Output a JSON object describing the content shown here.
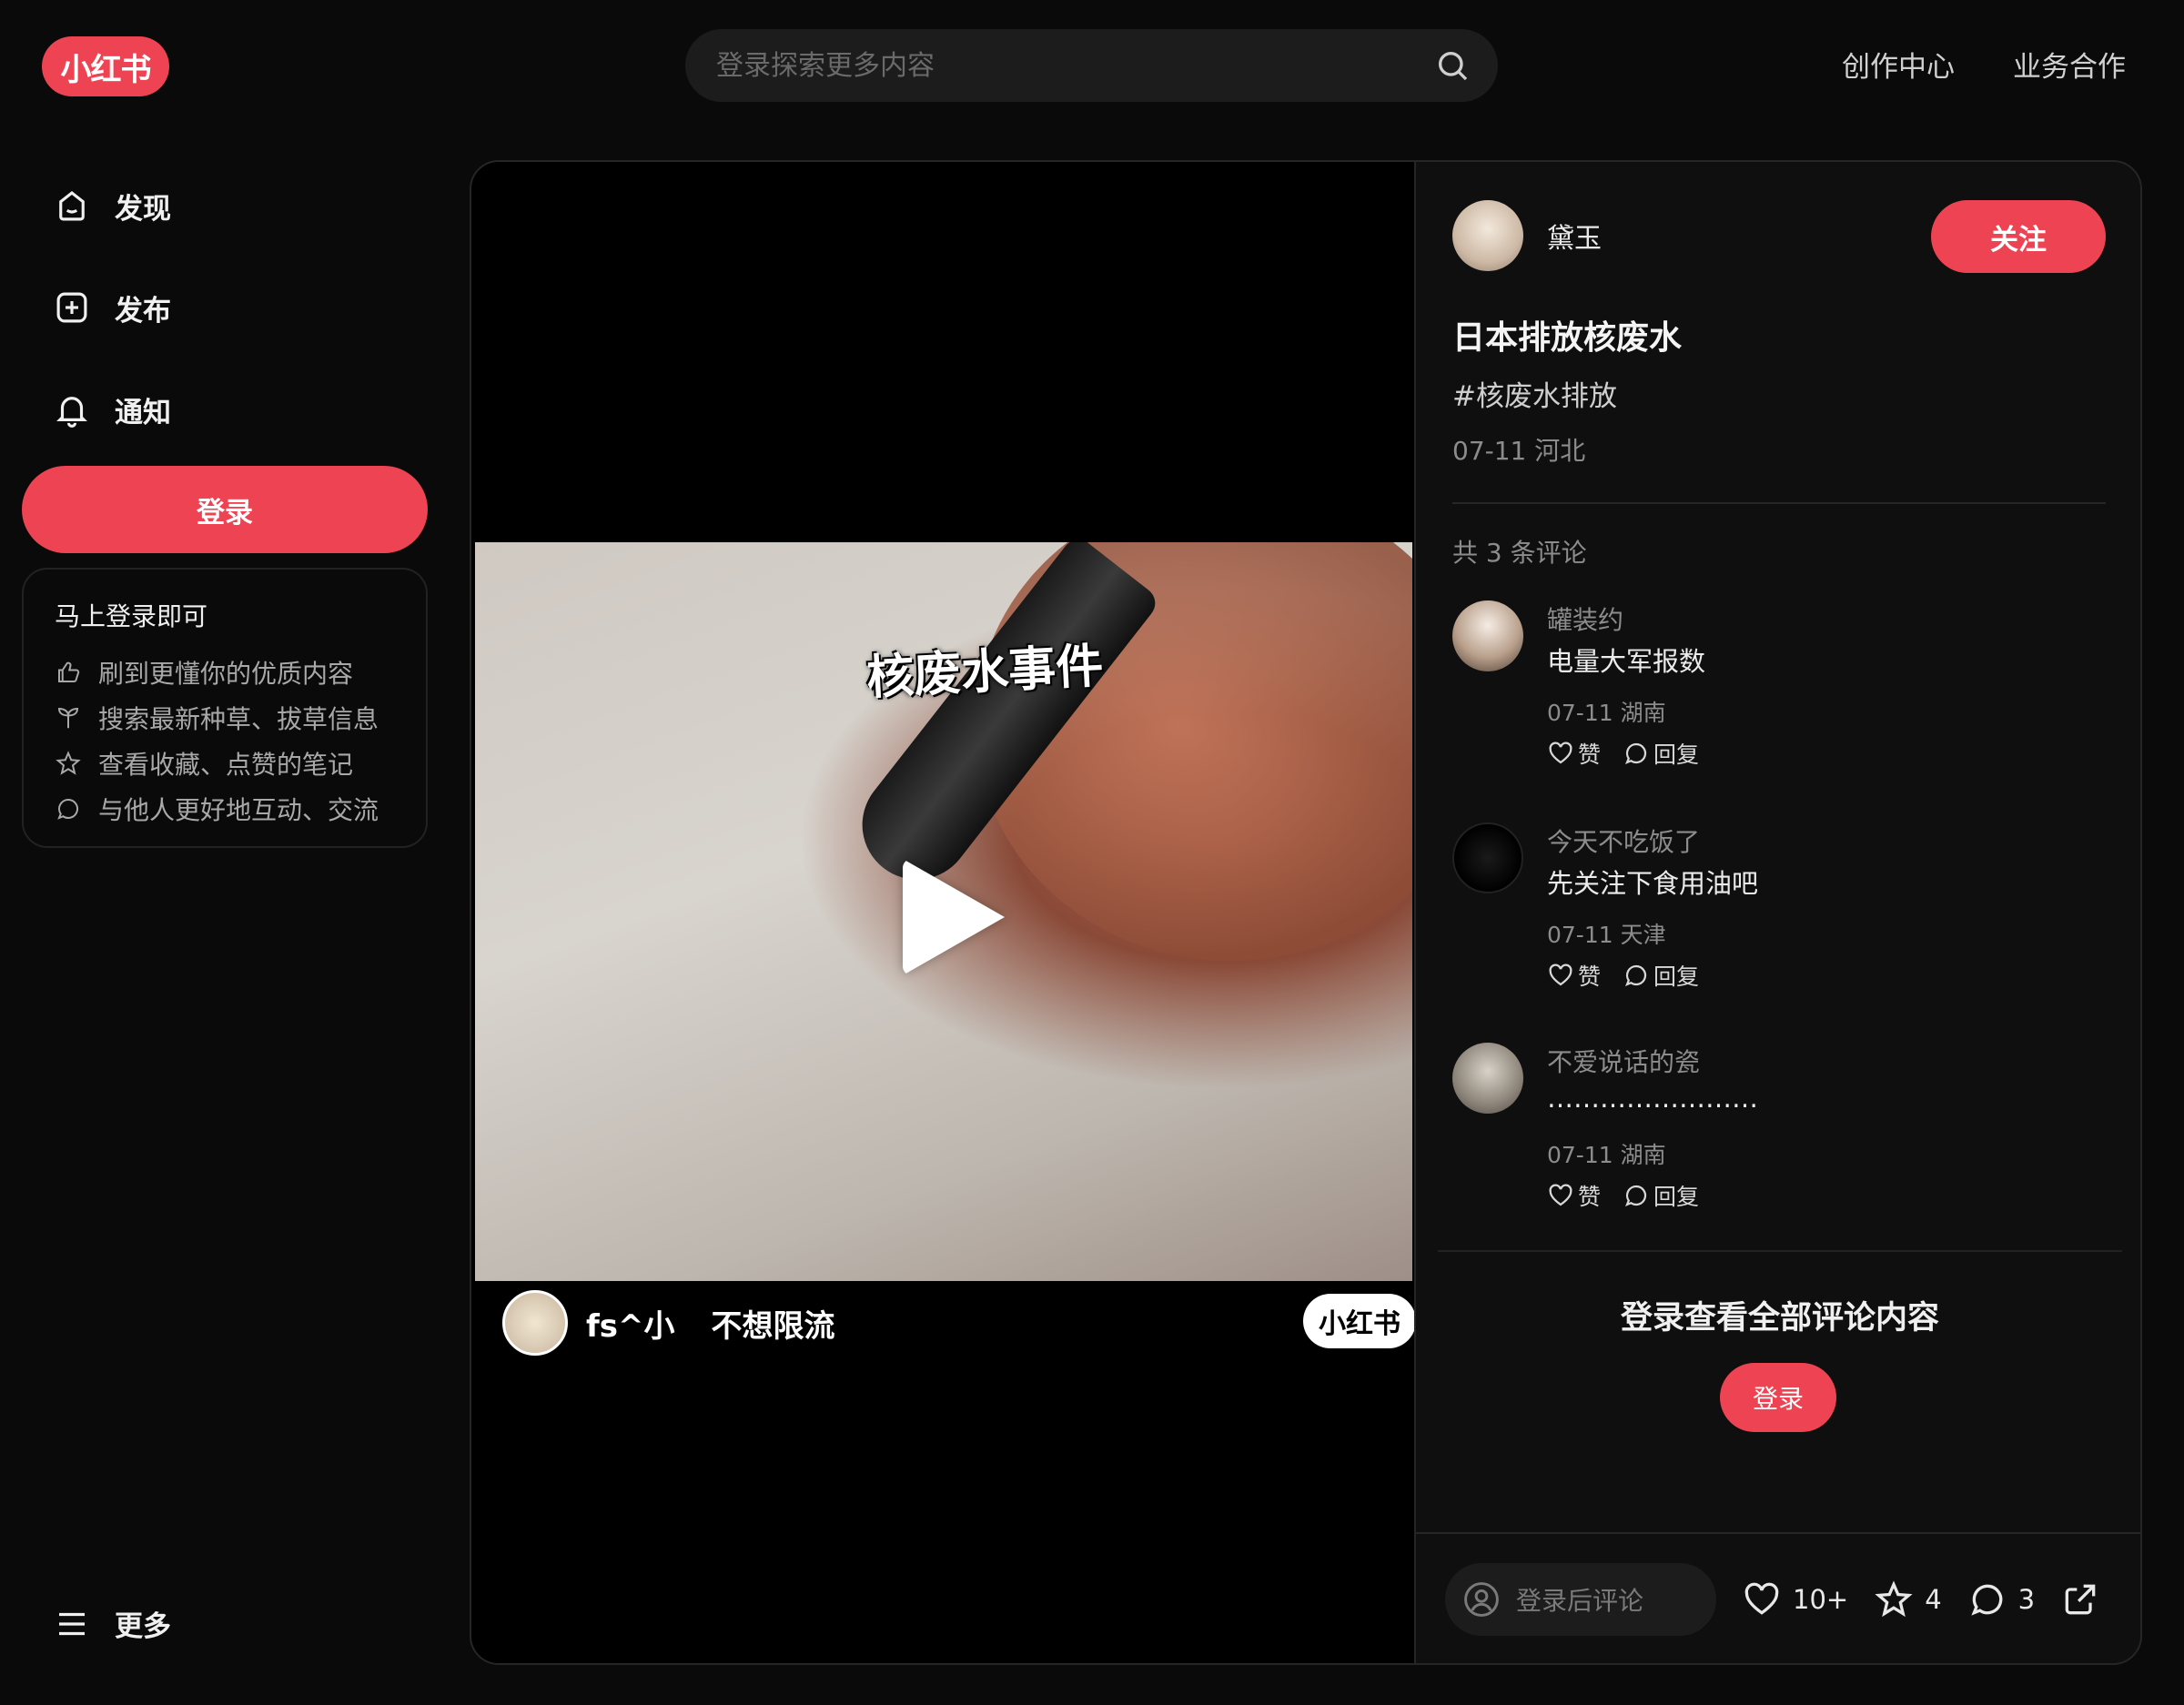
{
  "header": {
    "logo": "小红书",
    "search_placeholder": "登录探索更多内容",
    "links": [
      "创作中心",
      "业务合作"
    ]
  },
  "sidebar": {
    "items": [
      {
        "label": "发现",
        "icon": "home-icon"
      },
      {
        "label": "发布",
        "icon": "plus-square-icon"
      },
      {
        "label": "通知",
        "icon": "bell-icon"
      }
    ],
    "login_label": "登录",
    "promo": {
      "title": "马上登录即可",
      "rows": [
        {
          "text": "刷到更懂你的优质内容",
          "icon": "thumbs-up-icon"
        },
        {
          "text": "搜索最新种草、拔草信息",
          "icon": "sprout-icon"
        },
        {
          "text": "查看收藏、点赞的笔记",
          "icon": "star-icon"
        },
        {
          "text": "与他人更好地互动、交流",
          "icon": "chat-icon"
        }
      ]
    },
    "more_label": "更多"
  },
  "video": {
    "caption": "核废水事件",
    "watermark_user": "fs^小",
    "watermark_tag": "不想限流",
    "watermark_brand": "小红书"
  },
  "post": {
    "author": "黛玉",
    "follow_label": "关注",
    "title": "日本排放核废水",
    "hashtag": "#核废水排放",
    "meta": "07-11 河北",
    "comment_count": "共 3 条评论",
    "comments": [
      {
        "user": "罐装约",
        "text": "电量大军报数",
        "meta": "07-11 湖南",
        "like": "赞",
        "reply": "回复"
      },
      {
        "user": "今天不吃饭了",
        "text": "先关注下食用油吧",
        "meta": "07-11 天津",
        "like": "赞",
        "reply": "回复"
      },
      {
        "user": "不爱说话的瓷",
        "text": "……………………",
        "meta": "07-11 湖南",
        "like": "赞",
        "reply": "回复"
      }
    ],
    "cta_text": "登录查看全部评论内容",
    "cta_button": "登录"
  },
  "bottom_bar": {
    "comment_placeholder": "登录后评论",
    "likes": "10+",
    "collects": "4",
    "comments": "3"
  },
  "colors": {
    "accent": "#ee4352",
    "background": "#0a0a0a"
  }
}
